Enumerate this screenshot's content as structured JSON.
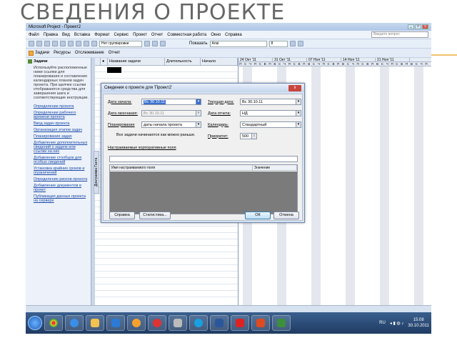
{
  "slide": {
    "title": "СВЕДЕНИЯ О ПРОЕКТЕ"
  },
  "window": {
    "title": "Microsoft Project - Проект2"
  },
  "menu": [
    "Файл",
    "Правка",
    "Вид",
    "Вставка",
    "Формат",
    "Сервис",
    "Проект",
    "Отчет",
    "Совместная работа",
    "Окно",
    "Справка"
  ],
  "help_placeholder": "Введите вопрос",
  "toolbar": {
    "grouping": "Нет группировки",
    "show": "Показать",
    "font": "Arial",
    "size": "8"
  },
  "toolbar2": {
    "tasks": "Задачи",
    "resources": "Ресурсы",
    "tracking": "Отслеживание",
    "report": "Отчет"
  },
  "taskpane": {
    "title": "Задачи",
    "intro": "Используйте расположенные ниже ссылки для планирования и составления календарных планов задач проекта. При щелчке ссылки отображаются средства для завершения шага и соответствующие инструкции.",
    "links": [
      "Определение проекта",
      "Определение рабочего времени проекта",
      "Ввод задач проекта",
      "Организация этапов задач",
      "Планирование задач",
      "Добавление дополнительных сведений о задаче или ссылки на них",
      "Добавление столбцов для особых сведений",
      "Установка крайних сроков и ограничений",
      "Определение рисков проекта",
      "Добавление документов в проект",
      "Публикация данных проекта на сервере"
    ]
  },
  "grid": {
    "headers": [
      "Название задачи",
      "Длительность",
      "Начало"
    ],
    "side_label": "Диаграмма Ганта"
  },
  "gantt": {
    "weeks": [
      "24 Окт '11",
      "31 Окт '11",
      "07 Ноя '11",
      "14 Ноя '11",
      "21 Ноя '11"
    ],
    "days": [
      "П",
      "С",
      "Ч",
      "П",
      "С",
      "В",
      "П",
      "В",
      "С",
      "Ч",
      "П",
      "С",
      "В",
      "П",
      "В",
      "С",
      "Ч",
      "П",
      "С",
      "В",
      "П",
      "В",
      "С",
      "Ч",
      "П",
      "С",
      "В",
      "П",
      "В",
      "С",
      "Ч",
      "П",
      "С",
      "В",
      "П",
      "В",
      "С",
      "Ч",
      "П"
    ]
  },
  "dialog": {
    "title": "Сведения о проекте для 'Проект2'",
    "start_label": "Дата начала:",
    "start_value": "Вс 30.10.11",
    "end_label": "Дата окончания:",
    "end_value": "Вс 30.10.11",
    "schedule_label": "Планирование",
    "schedule_value": "даты начала проекта",
    "schedule_note": "Все задачи начинаются как можно раньше.",
    "current_label": "Текущая дата:",
    "current_value": "Вс 30.10.11",
    "status_label": "Дата отчета:",
    "status_value": "НД",
    "calendar_label": "Календарь:",
    "calendar_value": "Стандартный",
    "priority_label": "Приоритет:",
    "priority_value": "500",
    "fields_label": "Настраиваемые корпоративные поля",
    "col_field": "Имя настраиваемого поля",
    "col_value": "Значение",
    "help_btn": "Справка",
    "stats_btn": "Статистика...",
    "ok_btn": "ОК",
    "cancel_btn": "Отмена"
  },
  "taskbar": {
    "lang": "RU",
    "time": "15:08",
    "date": "30.10.2011"
  },
  "colors": {
    "accent": "#1a4aa8",
    "ok": "#3c7fb1"
  }
}
